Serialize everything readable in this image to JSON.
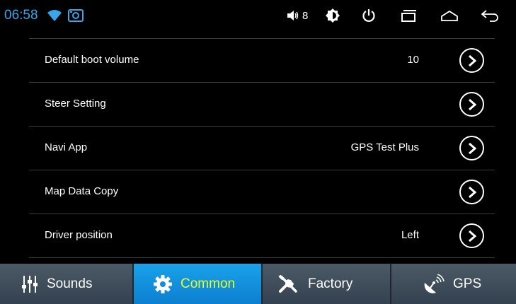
{
  "status": {
    "time": "06:58",
    "volume_level": "8",
    "icons": [
      "wifi-icon",
      "photo-icon",
      "volume-icon",
      "brightness-icon",
      "power-icon",
      "recent-apps-icon",
      "home-icon",
      "back-icon"
    ]
  },
  "settings": [
    {
      "label": "Default boot volume",
      "value": "10"
    },
    {
      "label": "Steer Setting",
      "value": ""
    },
    {
      "label": "Navi App",
      "value": "GPS Test Plus"
    },
    {
      "label": "Map Data Copy",
      "value": ""
    },
    {
      "label": "Driver position",
      "value": "Left"
    }
  ],
  "tabs": [
    {
      "label": "Sounds",
      "icon": "sliders-icon"
    },
    {
      "label": "Common",
      "icon": "gear-icon",
      "active": true
    },
    {
      "label": "Factory",
      "icon": "tools-icon"
    },
    {
      "label": "GPS",
      "icon": "satellite-icon"
    }
  ],
  "colors": {
    "time": "#3aa5e8",
    "active_tab_bg": "#1aa2ea",
    "active_tab_text": "#e6ff2a",
    "tab_bg": "#4c5966"
  }
}
